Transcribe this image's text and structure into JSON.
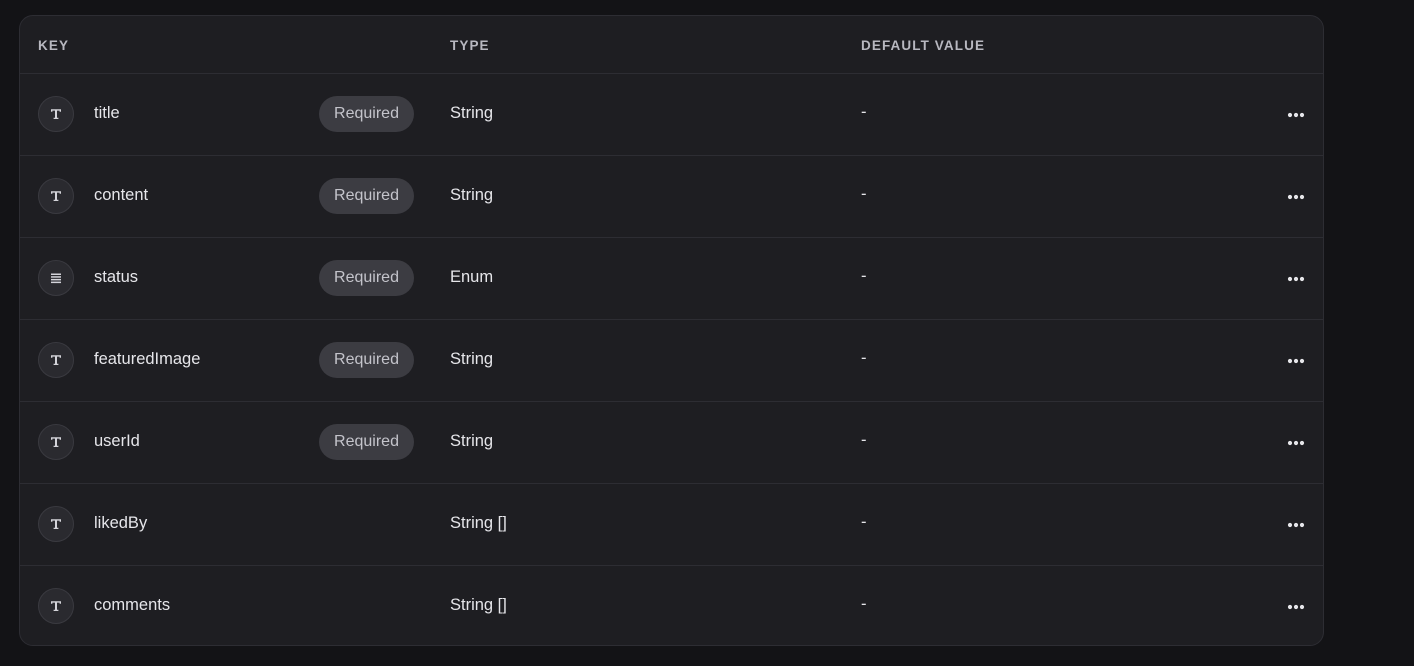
{
  "columns": {
    "key": "KEY",
    "type": "TYPE",
    "default": "DEFAULT VALUE"
  },
  "rows": [
    {
      "icon": "text-type-icon",
      "key": "title",
      "badge": "Required",
      "type": "String",
      "default": "-"
    },
    {
      "icon": "text-type-icon",
      "key": "content",
      "badge": "Required",
      "type": "String",
      "default": "-"
    },
    {
      "icon": "enum-list-icon",
      "key": "status",
      "badge": "Required",
      "type": "Enum",
      "default": "-"
    },
    {
      "icon": "text-type-icon",
      "key": "featuredImage",
      "badge": "Required",
      "type": "String",
      "default": "-"
    },
    {
      "icon": "text-type-icon",
      "key": "userId",
      "badge": "Required",
      "type": "String",
      "default": "-"
    },
    {
      "icon": "text-type-icon",
      "key": "likedBy",
      "badge": "",
      "type": "String []",
      "default": "-"
    },
    {
      "icon": "text-type-icon",
      "key": "comments",
      "badge": "",
      "type": "String []",
      "default": "-"
    }
  ],
  "row_action_icon": "more-horizontal-icon"
}
